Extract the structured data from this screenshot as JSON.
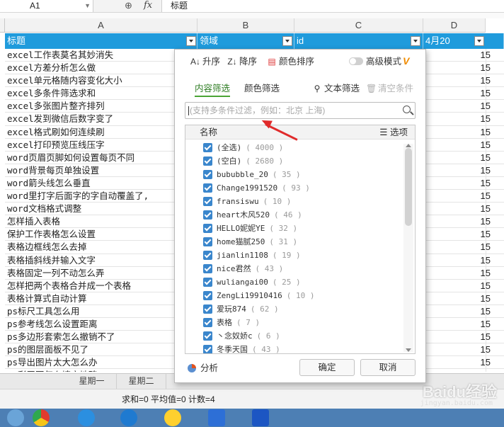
{
  "formula_bar": {
    "cell_ref": "A1",
    "fx": "fx",
    "content": "标题"
  },
  "columns": [
    "A",
    "B",
    "C",
    "D"
  ],
  "header_row": [
    "标题",
    "领域",
    "id",
    "4月20"
  ],
  "rows": [
    {
      "a": "excel工作表莫名其妙消失",
      "d": "15"
    },
    {
      "a": "excel方差分析怎么做",
      "d": "15"
    },
    {
      "a": "excel单元格随内容变化大小",
      "d": "15"
    },
    {
      "a": "excel多条件筛选求和",
      "d": "15"
    },
    {
      "a": "excel多张图片整齐排列",
      "d": "15"
    },
    {
      "a": "excel发到微信后数字变了",
      "d": "15"
    },
    {
      "a": "excel格式刷如何连续刷",
      "d": "15"
    },
    {
      "a": "excel打印预览压线压字",
      "d": "15"
    },
    {
      "a": "word页眉页脚如何设置每页不同",
      "d": "15"
    },
    {
      "a": "word背景每页单独设置",
      "d": "15"
    },
    {
      "a": "word箭头线怎么垂直",
      "d": "15"
    },
    {
      "a": "word里打字后面字的字自动覆盖了,",
      "d": "15"
    },
    {
      "a": "word文档格式调整",
      "d": "15"
    },
    {
      "a": "怎样插入表格",
      "d": "15"
    },
    {
      "a": "保护工作表格怎么设置",
      "d": "15"
    },
    {
      "a": "表格边框线怎么去掉",
      "d": "15"
    },
    {
      "a": "表格插斜线并输入文字",
      "d": "15"
    },
    {
      "a": "表格固定一列不动怎么弄",
      "d": "15"
    },
    {
      "a": "怎样把两个表格合并成一个表格",
      "d": "15"
    },
    {
      "a": "表格计算式自动计算",
      "d": "15"
    },
    {
      "a": "ps标尺工具怎么用",
      "d": "15"
    },
    {
      "a": "ps参考线怎么设置距离",
      "d": "15"
    },
    {
      "a": "ps多边形套索怎么撤销不了",
      "d": "15"
    },
    {
      "a": "ps的图层面板不见了",
      "d": "15"
    },
    {
      "a": "ps导出图片太大怎么办",
      "d": "15"
    },
    {
      "a": "ps彩平图怎么填充地砖",
      "d": "15"
    }
  ],
  "sheet_tabs": [
    "星期一",
    "星期二"
  ],
  "status_bar": "求和=0  平均值=0  计数=4",
  "watermark": {
    "main": "Baidu经验",
    "sub": "jingyan.baidu.com"
  },
  "filter_panel": {
    "toolbar": {
      "asc": "升序",
      "desc": "降序",
      "color_sort": "颜色排序",
      "advanced": "高级模式"
    },
    "tabs": {
      "content": "内容筛选",
      "color": "颜色筛选"
    },
    "text_filter": "文本筛选",
    "clear": "清空条件",
    "search_placeholder": "(支持多条件过滤，例如：北京 上海)",
    "list_header": {
      "name": "名称",
      "options": "选项"
    },
    "items": [
      {
        "label": "(全选)",
        "count": "( 4000 )"
      },
      {
        "label": "(空白)",
        "count": "( 2680 )"
      },
      {
        "label": "bububble_20",
        "count": "( 35 )"
      },
      {
        "label": "Change1991520",
        "count": "( 93 )"
      },
      {
        "label": "fransiswu",
        "count": "( 10 )"
      },
      {
        "label": "heart木风520",
        "count": "( 46 )"
      },
      {
        "label": "HELLO妮妮YE",
        "count": "( 32 )"
      },
      {
        "label": "home猫腻250",
        "count": "( 31 )"
      },
      {
        "label": "jianlin1108",
        "count": "( 19 )"
      },
      {
        "label": "nice君然",
        "count": "( 43 )"
      },
      {
        "label": "wuliangai00",
        "count": "( 25 )"
      },
      {
        "label": "ZengLi19910416",
        "count": "( 10 )"
      },
      {
        "label": "爱玩874",
        "count": "( 62 )"
      },
      {
        "label": "表格",
        "count": "( 7 )"
      },
      {
        "label": "丶念奴娇c",
        "count": "( 6 )"
      },
      {
        "label": "冬季天国",
        "count": "( 43 )"
      }
    ],
    "analyze": "分析",
    "ok": "确定",
    "cancel": "取消"
  }
}
